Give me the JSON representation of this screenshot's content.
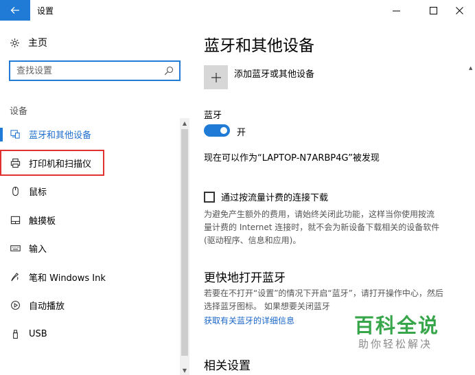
{
  "window": {
    "title": "设置",
    "controls": {
      "minimize": "minimize-icon",
      "maximize": "maximize-icon",
      "close": "close-icon"
    }
  },
  "sidebar": {
    "home_label": "主页",
    "search_placeholder": "查找设置",
    "section_label": "设备",
    "items": [
      {
        "label": "蓝牙和其他设备",
        "icon": "bluetooth-devices-icon",
        "active": true
      },
      {
        "label": "打印机和扫描仪",
        "icon": "printer-icon",
        "active": false
      },
      {
        "label": "鼠标",
        "icon": "mouse-icon",
        "active": false
      },
      {
        "label": "触摸板",
        "icon": "touchpad-icon",
        "active": false
      },
      {
        "label": "输入",
        "icon": "keyboard-icon",
        "active": false
      },
      {
        "label": "笔和 Windows Ink",
        "icon": "pen-icon",
        "active": false
      },
      {
        "label": "自动播放",
        "icon": "autoplay-icon",
        "active": false
      },
      {
        "label": "USB",
        "icon": "usb-icon",
        "active": false
      }
    ]
  },
  "main": {
    "title": "蓝牙和其他设备",
    "add_device_label": "添加蓝牙或其他设备",
    "bluetooth_label": "蓝牙",
    "toggle_state": "开",
    "toggle_on": true,
    "discoverable_text": "现在可以作为“LAPTOP-N7ARBP4G”被发现",
    "metered_label": "通过按流量计费的连接下载",
    "metered_checked": false,
    "metered_desc_lines": [
      "为避免产生额外的费用，请始终关闭此功能，这样当你使用按流",
      "量计费的 Internet 连接时，就不会为新设备下载相关的设备软件",
      "(驱动程序、信息和应用)。"
    ],
    "quick_title": "更快地打开蓝牙",
    "quick_desc_lines": [
      "若要在不打开“设置”的情况下开启“蓝牙”，请打开操作中心，然后",
      "选择蓝牙图标。 如果想要关闭蓝牙"
    ],
    "link_text": "获取有关蓝牙的详细信息",
    "related_title": "相关设置"
  },
  "watermark": {
    "title": "百科全说",
    "subtitle": "助你轻松解决"
  },
  "colors": {
    "accent": "#1f7bd6",
    "highlight_box": "#e0312f",
    "watermark_green": "#37a64a"
  }
}
